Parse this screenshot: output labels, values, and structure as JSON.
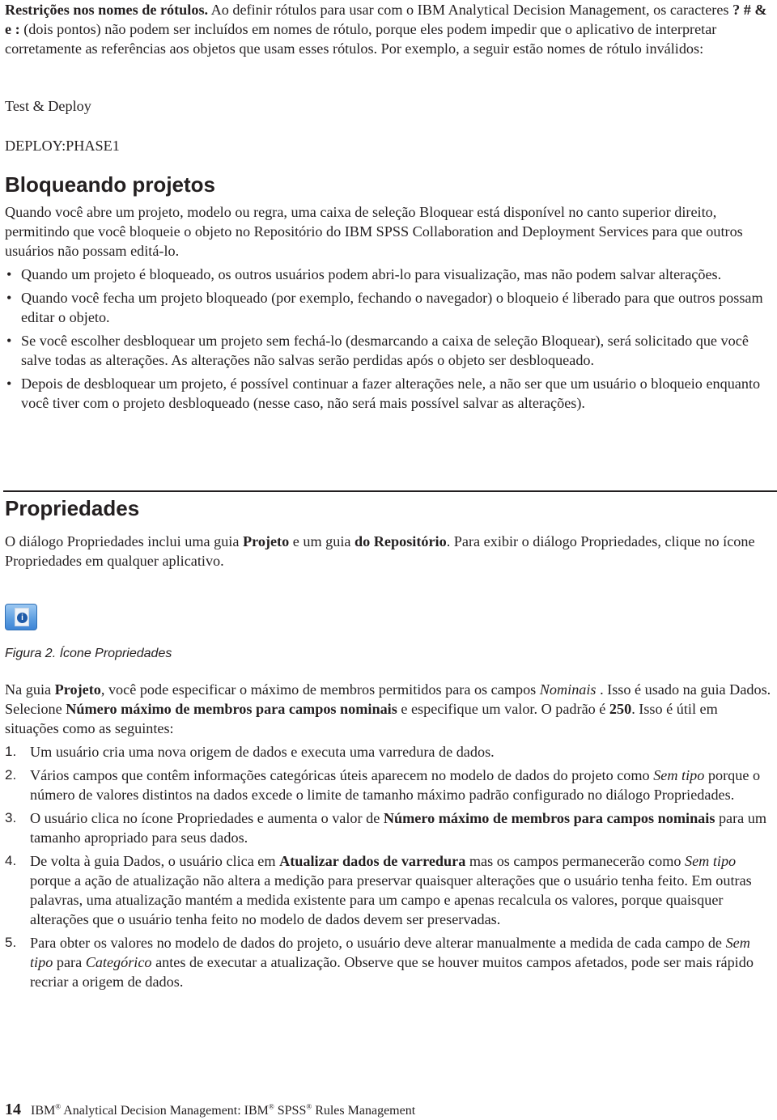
{
  "intro": {
    "lead_bold": "Restrições nos nomes de rótulos.",
    "text_1": " Ao definir rótulos para usar com o IBM Analytical Decision Management, os caracteres ",
    "chars_bold": "? # & e :",
    "text_2": " (dois pontos) não podem ser incluídos em nomes de rótulo, porque eles podem impedir que o aplicativo de interpretar corretamente as referências aos objetos que usam esses rótulos. Por exemplo, a seguir estão nomes de rótulo inválidos:"
  },
  "examples": [
    "Test & Deploy",
    "DEPLOY:PHASE1"
  ],
  "locking": {
    "heading": "Bloqueando projetos",
    "paragraph": "Quando você abre um projeto, modelo ou regra, uma caixa de seleção Bloquear está disponível no canto superior direito, permitindo que você bloqueie o objeto no Repositório do IBM SPSS Collaboration and Deployment Services para que outros usuários não possam editá-lo.",
    "bullet_glyph": "•",
    "bullets": [
      "Quando um projeto é bloqueado, os outros usuários podem abri-lo para visualização, mas não podem salvar alterações.",
      "Quando você fecha um projeto bloqueado (por exemplo, fechando o navegador) o bloqueio é liberado para que outros possam editar o objeto.",
      "Se você escolher desbloquear um projeto sem fechá-lo (desmarcando a caixa de seleção Bloquear), será solicitado que você salve todas as alterações. As alterações não salvas serão perdidas após o objeto ser desbloqueado.",
      "Depois de desbloquear um projeto, é possível continuar a fazer alterações nele, a não ser que um usuário o bloqueio enquanto você tiver com o projeto desbloqueado (nesse caso, não será mais possível salvar as alterações)."
    ]
  },
  "properties": {
    "heading": "Propriedades",
    "intro": {
      "t1": "O diálogo Propriedades inclui uma guia ",
      "b1": "Projeto",
      "t2": " e um guia ",
      "b2": "do Repositório",
      "t3": ". Para exibir o diálogo Propriedades, clique no ícone Propriedades em qualquer aplicativo."
    },
    "icon_glyph": "i",
    "figure_caption": "Figura 2. Ícone Propriedades",
    "para2": {
      "t1": "Na guia ",
      "b1": "Projeto",
      "t2": ", você pode especificar o máximo de membros permitidos para os campos ",
      "i1": "Nominais",
      "t3": " . Isso é usado na guia Dados. Selecione ",
      "b2": "Número máximo de membros para campos nominais",
      "t4": " e especifique um valor. O padrão é ",
      "b3": "250",
      "t5": ". Isso é útil em situações como as seguintes:"
    },
    "steps": [
      {
        "n": "1.",
        "t1": "Um usuário cria uma nova origem de dados e executa uma varredura de dados."
      },
      {
        "n": "2.",
        "t1": "Vários campos que contêm informações categóricas úteis aparecem no modelo de dados do projeto como ",
        "i1": "Sem tipo",
        "t2": " porque o número de valores distintos na dados excede o limite de tamanho máximo padrão configurado no diálogo Propriedades."
      },
      {
        "n": "3.",
        "t1": "O usuário clica no ícone Propriedades e aumenta o valor de ",
        "b1": "Número máximo de membros para campos nominais",
        "t2": " para um tamanho apropriado para seus dados."
      },
      {
        "n": "4.",
        "t1": "De volta à guia Dados, o usuário clica em ",
        "b1": "Atualizar dados de varredura",
        "t2": " mas os campos permanecerão como ",
        "i1": "Sem tipo",
        "t3": " porque a ação de atualização não altera a medição para preservar quaisquer alterações que o usuário tenha feito. Em outras palavras, uma atualização mantém a medida existente para um campo e apenas recalcula os valores, porque quaisquer alterações que o usuário tenha feito no modelo de dados devem ser preservadas."
      },
      {
        "n": "5.",
        "t1": "Para obter os valores no modelo de dados do projeto, o usuário deve alterar manualmente a medida de cada campo de ",
        "i1": "Sem tipo",
        "t2": " para ",
        "i2": "Categórico",
        "t3": " antes de executar a atualização. Observe que se houver muitos campos afetados, pode ser mais rápido recriar a origem de dados."
      }
    ]
  },
  "footer": {
    "page_number": "14",
    "t1": "IBM",
    "reg": "®",
    "t2": " Analytical Decision Management:  IBM",
    "t3": " SPSS",
    "t4": " Rules Management"
  }
}
